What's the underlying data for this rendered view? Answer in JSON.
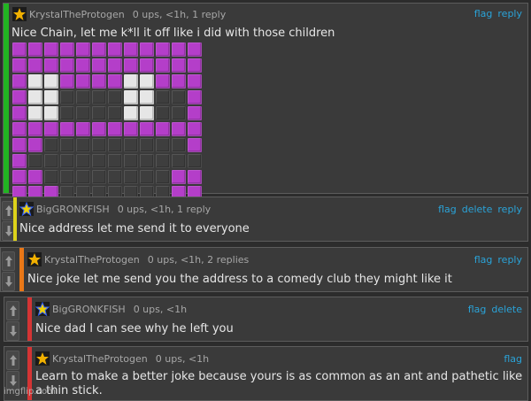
{
  "colors": {
    "green": "#22b422",
    "yellow": "#ddd21a",
    "orange": "#e97717",
    "red": "#d43434",
    "link": "#2aa3d8"
  },
  "comments": [
    {
      "user": "KrystalTheProtogen",
      "meta": "0 ups, <1h, 1 reply",
      "actions": [
        "flag",
        "reply"
      ],
      "text": "Nice Chain, let me k*ll it off like i did with those children"
    },
    {
      "user": "BigGRONKFISH",
      "meta": "0 ups, <1h, 1 reply",
      "actions": [
        "flag",
        "delete",
        "reply"
      ],
      "text": "Nice address let me send it to everyone"
    },
    {
      "user": "KrystalTheProtogen",
      "meta": "0 ups, <1h, 2 replies",
      "actions": [
        "flag",
        "reply"
      ],
      "text": "Nice joke let me send you the address to a comedy club they might like it"
    },
    {
      "user": "BigGRONKFISH",
      "meta": "0 ups, <1h",
      "actions": [
        "flag",
        "delete"
      ],
      "text": "Nice dad I can see why he left you"
    },
    {
      "user": "KrystalTheProtogen",
      "meta": "0 ups, <1h",
      "actions": [
        "flag"
      ],
      "text": "Learn to make a better joke because yours is as common as an ant and pathetic like a thin stick."
    }
  ],
  "pixel_art": {
    "rows": [
      "PPPPPPPPPPPP",
      "PPPPPPPPPPPP",
      "PWWPPPPWWPPP",
      "PWWDDDDWWDDP",
      "PWWDDDDWWDDP",
      "PPPPPPPPPPPP",
      "PPDDDDDDDDDP",
      "PDDDDDDDDDDD",
      "PPDDDDDDDDPP",
      "PPPDDDDDDDPP"
    ]
  },
  "watermark": "imgflip.com"
}
